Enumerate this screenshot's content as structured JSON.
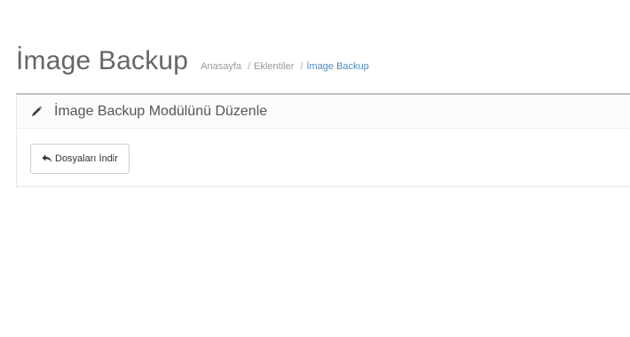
{
  "header": {
    "title": "İmage Backup",
    "breadcrumb": [
      {
        "label": "Anasayfa"
      },
      {
        "label": "Eklentiler"
      },
      {
        "label": "İmage Backup"
      }
    ],
    "breadcrumb_separator": "/"
  },
  "panel": {
    "icon": "pencil-icon",
    "title": "İmage Backup Modülünü Düzenle",
    "download_button": {
      "icon": "reply-icon",
      "label": "Dosyaları İndir"
    }
  },
  "colors": {
    "active_breadcrumb": "#4a8bc2",
    "panel_top_border": "#bfbfbf"
  }
}
